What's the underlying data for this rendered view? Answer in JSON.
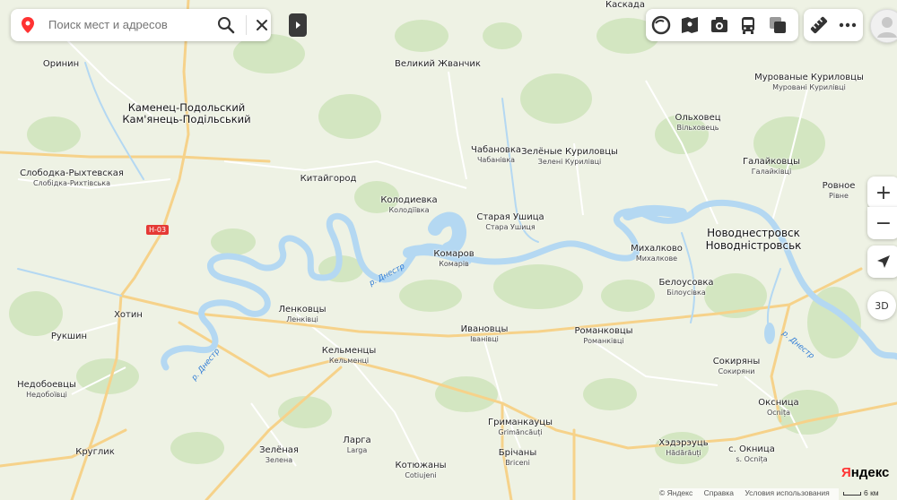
{
  "search": {
    "placeholder": "Поиск мест и адресов"
  },
  "colors": {
    "water": "#b4d8f2",
    "forest": "#d3e6c1",
    "land": "#eef2e4",
    "road_major": "#f6d28a",
    "road_minor": "#ffffff",
    "brand": "#ff3333"
  },
  "toolbar": {
    "icons": [
      "layers-icon",
      "panorama-icon",
      "photo-icon",
      "transport-icon",
      "traffic-icon",
      "ruler-icon",
      "more-icon"
    ]
  },
  "road_badge": "Н-03",
  "places": [
    {
      "name": "Каскада"
    },
    {
      "name": "Оринин"
    },
    {
      "name": "Великий Жванчик"
    },
    {
      "name": "Мурованые Куриловцы",
      "local": "Муровані Курилівці"
    },
    {
      "name": "Каменец-Подольский",
      "local": "Кам'янець-Подільський"
    },
    {
      "name": "Ольховец",
      "local": "Вільховець"
    },
    {
      "name": "Чабановка",
      "local": "Чабанівка"
    },
    {
      "name": "Зелёные Куриловцы",
      "local": "Зелені Курилівці"
    },
    {
      "name": "Галайковцы",
      "local": "Галайківці"
    },
    {
      "name": "Слободка-Рыхтевская",
      "local": "Слобідка-Рихтівська"
    },
    {
      "name": "Китайгород"
    },
    {
      "name": "Колодиевка",
      "local": "Колодіївка"
    },
    {
      "name": "Ровное",
      "local": "Рівне"
    },
    {
      "name": "Старая Ушица",
      "local": "Стара Ушиця"
    },
    {
      "name": "Новоднестровск",
      "local": "Новодністровськ"
    },
    {
      "name": "Михалково",
      "local": "Михалкове"
    },
    {
      "name": "Комаров",
      "local": "Комарів"
    },
    {
      "name": "Белоусовка",
      "local": "Білоусівка"
    },
    {
      "name": "Ленковцы",
      "local": "Ленківці"
    },
    {
      "name": "Хотин"
    },
    {
      "name": "Ивановцы",
      "local": "Іванівці"
    },
    {
      "name": "Романковцы",
      "local": "Романківці"
    },
    {
      "name": "Рукшин"
    },
    {
      "name": "Кельменцы",
      "local": "Кельменці"
    },
    {
      "name": "Сокиряны",
      "local": "Сокиряни"
    },
    {
      "name": "Недобоевцы",
      "local": "Недобоївці"
    },
    {
      "name": "Оксница",
      "local": "Ocnița"
    },
    {
      "name": "Гриманкауцы",
      "local": "Grimăncăuți"
    },
    {
      "name": "Хэдэрэуць",
      "local": "Hădărăuți"
    },
    {
      "name": "с. Окница",
      "local": "s. Ocnița"
    },
    {
      "name": "Круглик"
    },
    {
      "name": "Зелёная",
      "local": "Зелена"
    },
    {
      "name": "Ларга",
      "local": "Larga"
    },
    {
      "name": "Брічаны",
      "local": "Briceni"
    },
    {
      "name": "Котюжаны",
      "local": "Cotiujeni"
    }
  ],
  "river_labels": [
    "р. Днестр",
    "р. Днестр",
    "р. Днестр"
  ],
  "zoom_in": "+",
  "zoom_out": "−",
  "btn_3d": "3D",
  "logo": {
    "first": "Я",
    "rest": "ндекс"
  },
  "footer": {
    "copyright": "© Яндекс",
    "help": "Справка",
    "terms": "Условия использования"
  },
  "scale": "6 км"
}
